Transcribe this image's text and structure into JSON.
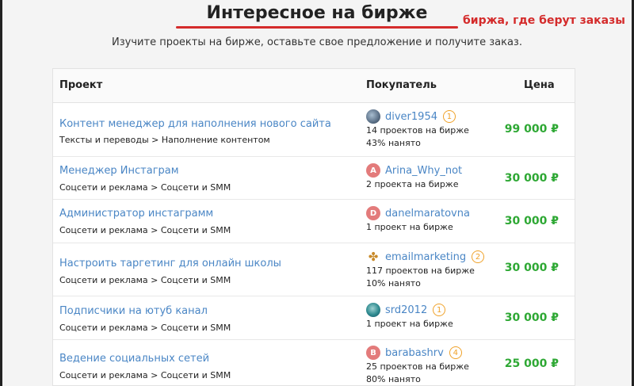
{
  "header": {
    "title": "Интересное на бирже",
    "annotation": "биржа, где берут заказы",
    "subtitle": "Изучите проекты на бирже, оставьте свое предложение и получите заказ."
  },
  "table": {
    "columns": {
      "project": "Проект",
      "buyer": "Покупатель",
      "price": "Цена"
    },
    "rows": [
      {
        "title": "Контент менеджер для наполнения нового сайта",
        "category": "Тексты и переводы > Наполнение контентом",
        "buyer_name": "diver1954",
        "avatar_letter": "",
        "avatar_icon": "user-photo-icon",
        "level": "1",
        "stats": [
          "14 проектов на бирже",
          "43% нанято"
        ],
        "price": "99 000 ₽"
      },
      {
        "title": "Менеджер Инстаграм",
        "category": "Соцсети и реклама > Соцсети и SMM",
        "buyer_name": "Arina_Why_not",
        "avatar_letter": "A",
        "avatar_color": "#e37b7b",
        "level": "",
        "stats": [
          "2 проекта на бирже"
        ],
        "price": "30 000 ₽"
      },
      {
        "title": "Администратор инстаграмм",
        "category": "Соцсети и реклама > Соцсети и SMM",
        "buyer_name": "danelmaratovna",
        "avatar_letter": "D",
        "avatar_color": "#e37b7b",
        "level": "",
        "stats": [
          "1 проект на бирже"
        ],
        "price": "30 000 ₽"
      },
      {
        "title": "Настроить таргетинг для онлайн школы",
        "category": "Соцсети и реклама > Соцсети и SMM",
        "buyer_name": "emailmarketing",
        "avatar_letter": "",
        "avatar_icon": "fidget-spinner-icon",
        "level": "2",
        "stats": [
          "117 проектов на бирже",
          "10% нанято"
        ],
        "price": "30 000 ₽"
      },
      {
        "title": "Подписчики на ютуб канал",
        "category": "Соцсети и реклама > Соцсети и SMM",
        "buyer_name": "srd2012",
        "avatar_letter": "",
        "avatar_icon": "user-photo-icon",
        "level": "1",
        "stats": [
          "1 проект на бирже"
        ],
        "price": "30 000 ₽"
      },
      {
        "title": "Ведение социальных сетей",
        "category": "Соцсети и реклама > Соцсети и SMM",
        "buyer_name": "barabashrv",
        "avatar_letter": "B",
        "avatar_color": "#e37b7b",
        "level": "4",
        "stats": [
          "25 проектов на бирже",
          "80% нанято"
        ],
        "price": "25 000 ₽"
      }
    ]
  },
  "colors": {
    "link": "#4a86c5",
    "price": "#2ea834",
    "accent_red": "#d42b2b",
    "badge": "#f0a22a"
  }
}
